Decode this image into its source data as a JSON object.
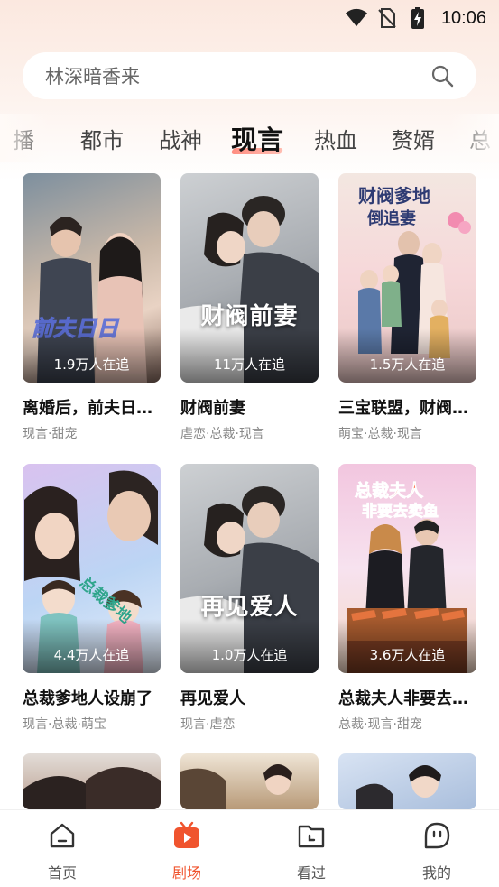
{
  "status_bar": {
    "time": "10:06",
    "icons": [
      "wifi-icon",
      "no-sim-icon",
      "battery-charging-icon"
    ]
  },
  "search": {
    "placeholder": "林深暗香来"
  },
  "category_tabs": [
    {
      "label": "播",
      "active": false
    },
    {
      "label": "都市",
      "active": false
    },
    {
      "label": "战神",
      "active": false
    },
    {
      "label": "现言",
      "active": true
    },
    {
      "label": "热血",
      "active": false
    },
    {
      "label": "赘婿",
      "active": false
    },
    {
      "label": "总",
      "active": false
    }
  ],
  "dramas": [
    {
      "title": "离婚后，前夫日…",
      "tags": "现言·甜宠",
      "viewers": "1.9万人在追",
      "cover_text": ""
    },
    {
      "title": "财阀前妻",
      "tags": "虐恋·总裁·现言",
      "viewers": "11万人在追",
      "cover_text": "财阀前妻"
    },
    {
      "title": "三宝联盟，财阀…",
      "tags": "萌宝·总裁·现言",
      "viewers": "1.5万人在追",
      "cover_text": ""
    },
    {
      "title": "总裁爹地人设崩了",
      "tags": "现言·总裁·萌宝",
      "viewers": "4.4万人在追",
      "cover_text": ""
    },
    {
      "title": "再见爱人",
      "tags": "现言·虐恋",
      "viewers": "1.0万人在追",
      "cover_text": "再见爱人"
    },
    {
      "title": "总裁夫人非要去…",
      "tags": "总裁·现言·甜宠",
      "viewers": "3.6万人在追",
      "cover_text": ""
    },
    {
      "title": "",
      "tags": "",
      "viewers": "",
      "cover_text": ""
    },
    {
      "title": "",
      "tags": "",
      "viewers": "",
      "cover_text": ""
    },
    {
      "title": "",
      "tags": "",
      "viewers": "",
      "cover_text": ""
    }
  ],
  "bottom_nav": [
    {
      "label": "首页",
      "icon": "home-icon",
      "active": false
    },
    {
      "label": "剧场",
      "icon": "theater-play-icon",
      "active": true
    },
    {
      "label": "看过",
      "icon": "history-folder-icon",
      "active": false
    },
    {
      "label": "我的",
      "icon": "profile-face-icon",
      "active": false
    }
  ],
  "colors": {
    "accent": "#f0542e",
    "tab_underline": "#ff7a6b",
    "header_bg": "#fbe8df"
  }
}
